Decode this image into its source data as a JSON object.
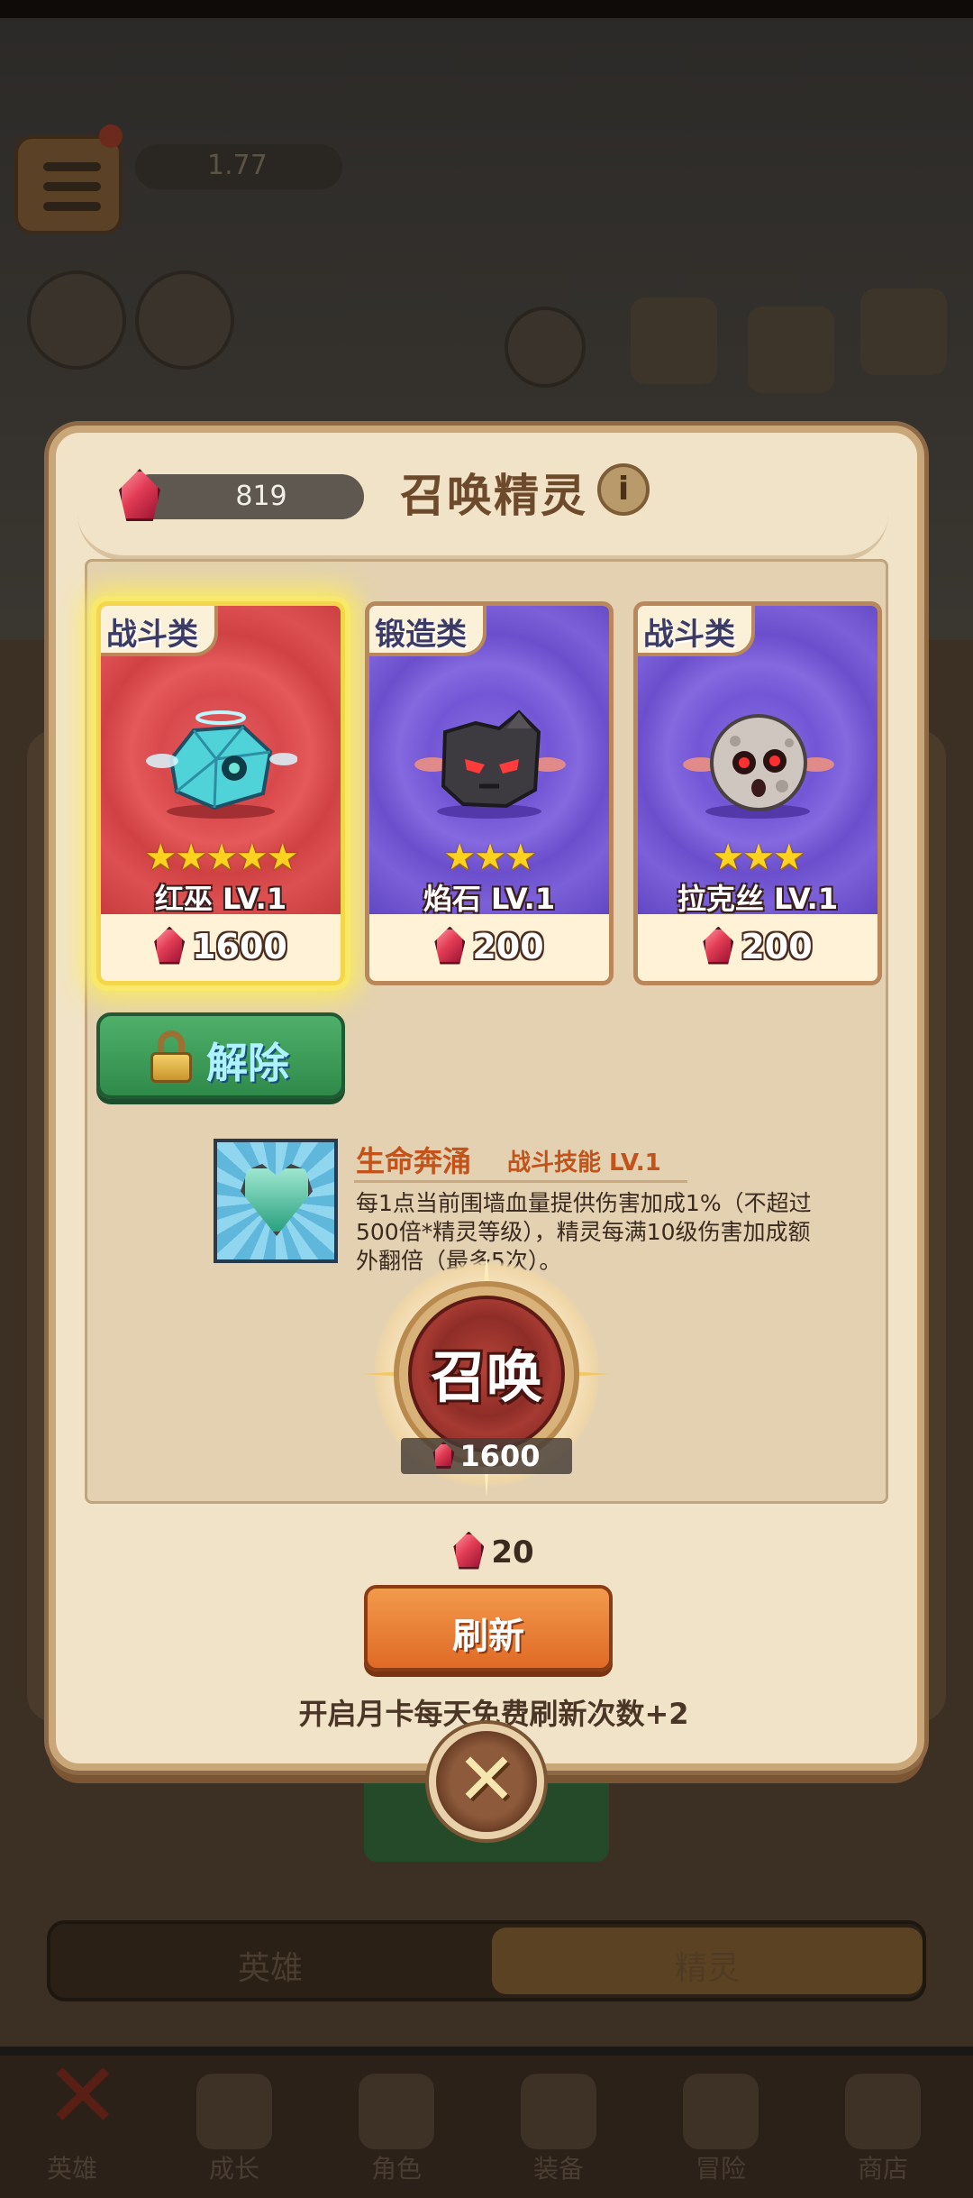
{
  "currency": {
    "gems": "819"
  },
  "dialog": {
    "title": "召唤精灵"
  },
  "cards": [
    {
      "tag": "战斗类",
      "stars": "★★★★★",
      "name": "红巫  LV.1",
      "price": "1600"
    },
    {
      "tag": "锻造类",
      "stars": "★★★",
      "name": "焰石  LV.1",
      "price": "200"
    },
    {
      "tag": "战斗类",
      "stars": "★★★",
      "name": "拉克丝  LV.1",
      "price": "200"
    }
  ],
  "unlock": {
    "label": "解除"
  },
  "skill": {
    "name": "生命奔涌",
    "level": "战斗技能 LV.1",
    "description": "每1点当前围墙血量提供伤害加成1%（不超过500倍*精灵等级），精灵每满10级伤害加成额外翻倍（最多5次）。"
  },
  "summon": {
    "label": "召唤",
    "cost": "1600"
  },
  "refresh": {
    "cost": "20",
    "label": "刷新"
  },
  "month_card_text": "开启月卡每天免费刷新次数+2",
  "close": {
    "symbol": "✕"
  },
  "background": {
    "power": "1.77",
    "tabs": [
      "英雄",
      "精灵"
    ],
    "nav": [
      "英雄",
      "成长",
      "角色",
      "装备",
      "冒险",
      "商店"
    ]
  },
  "colors": {
    "gem": "#e23c55",
    "refresh": "#e06a26",
    "unlock": "#2f8a4a",
    "dialog_bg": "#f1e3c7"
  }
}
